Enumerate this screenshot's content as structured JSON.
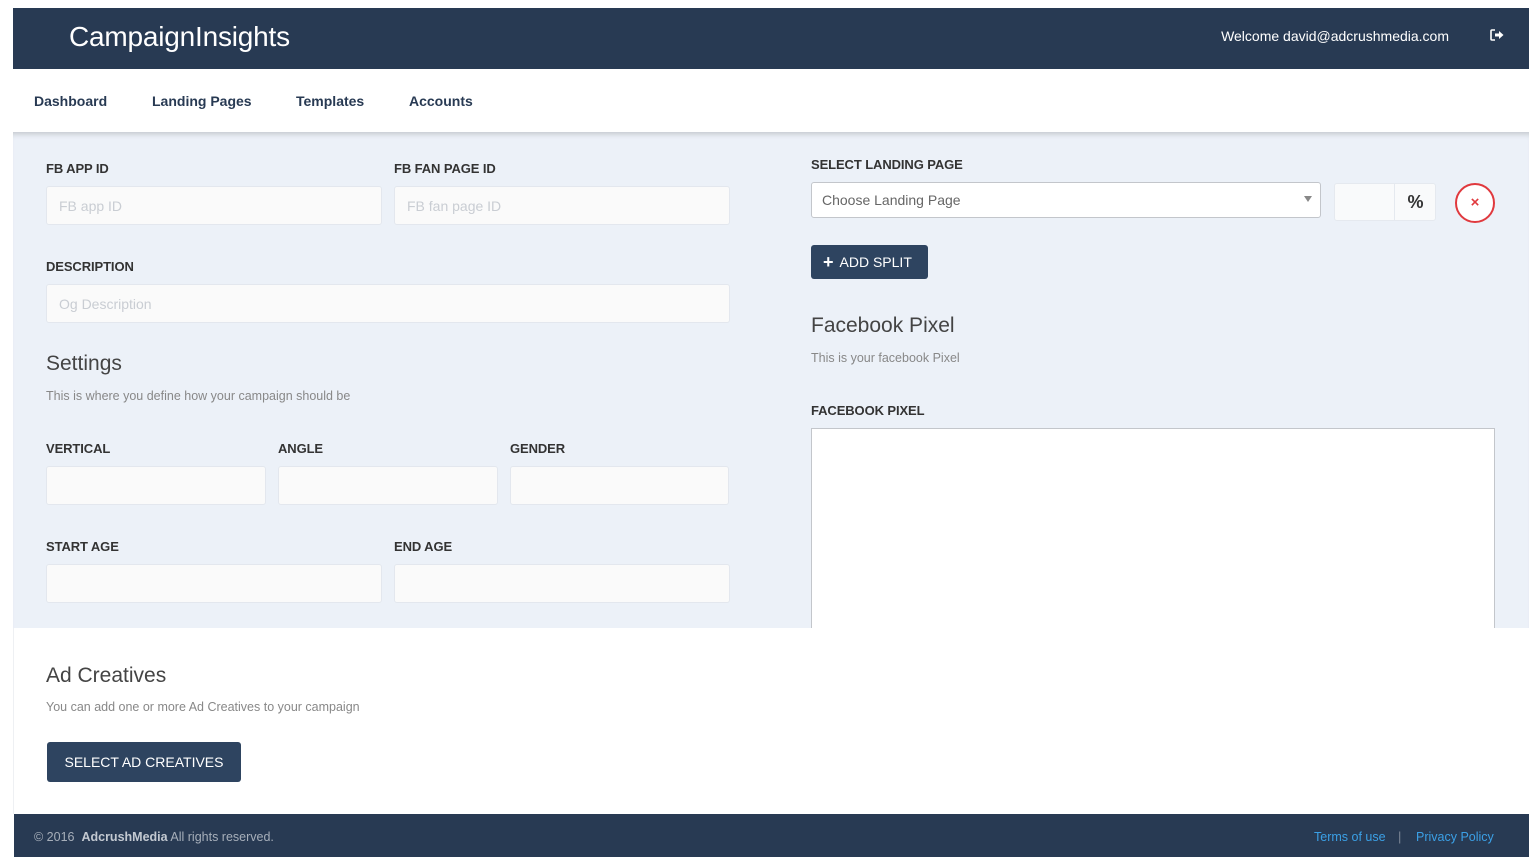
{
  "header": {
    "brand": "CampaignInsights",
    "welcome": "Welcome david@adcrushmedia.com",
    "logout_icon": "sign-out-icon"
  },
  "nav": {
    "items": [
      {
        "label": "Dashboard"
      },
      {
        "label": "Landing Pages"
      },
      {
        "label": "Templates"
      },
      {
        "label": "Accounts"
      }
    ]
  },
  "form": {
    "fb_app_id": {
      "label": "FB APP ID",
      "placeholder": "FB app ID",
      "value": ""
    },
    "fb_fan_page_id": {
      "label": "FB FAN PAGE ID",
      "placeholder": "FB fan page ID",
      "value": ""
    },
    "description": {
      "label": "DESCRIPTION",
      "placeholder": "Og Description",
      "value": ""
    },
    "settings": {
      "title": "Settings",
      "subtitle": "This is where you define how your campaign should be",
      "vertical": {
        "label": "VERTICAL",
        "value": ""
      },
      "angle": {
        "label": "ANGLE",
        "value": ""
      },
      "gender": {
        "label": "GENDER",
        "value": ""
      },
      "start_age": {
        "label": "START AGE",
        "value": ""
      },
      "end_age": {
        "label": "END AGE",
        "value": ""
      }
    }
  },
  "landing": {
    "label": "SELECT LANDING PAGE",
    "select_placeholder": "Choose Landing Page",
    "percent_value": "",
    "percent_symbol": "%",
    "remove_icon": "×",
    "add_split_icon": "+",
    "add_split_label": "ADD SPLIT"
  },
  "pixel": {
    "title": "Facebook Pixel",
    "subtitle": "This is your facebook Pixel",
    "label": "FACEBOOK PIXEL",
    "value": ""
  },
  "creatives": {
    "title": "Ad Creatives",
    "subtitle": "You can add one or more Ad Creatives to your campaign",
    "button_label": "SELECT AD CREATIVES"
  },
  "footer": {
    "copyright_prefix": "© 2016",
    "company": "AdcrushMedia",
    "copyright_suffix": "All rights reserved.",
    "separator": "|",
    "links": [
      {
        "label": "Terms of use"
      },
      {
        "label": "Privacy Policy"
      }
    ]
  },
  "colors": {
    "header_bg": "#283a53",
    "form_bg": "#ecf1f8",
    "button_bg": "#2e4460",
    "danger": "#e0393e",
    "link": "#3ba0e6"
  }
}
